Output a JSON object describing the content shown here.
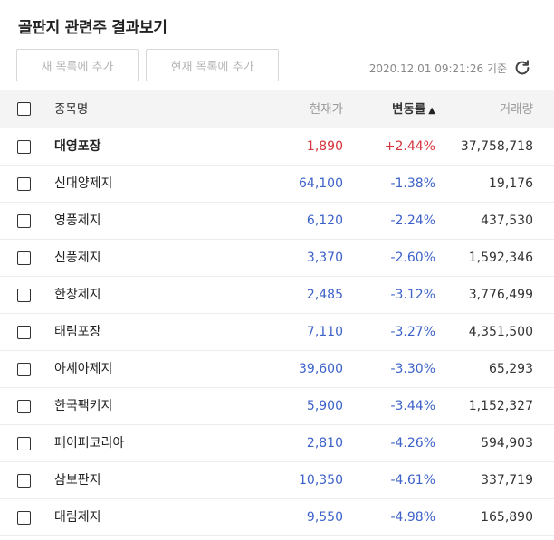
{
  "title": "골판지 관련주 결과보기",
  "buttons": {
    "add_new": "새 목록에 추가",
    "add_current": "현재 목록에 추가"
  },
  "timestamp": "2020.12.01 09:21:26 기준",
  "icons": {
    "refresh": "refresh-icon",
    "sort": "sort-ascending-icon"
  },
  "colors": {
    "up": "#d6333b",
    "down": "#3d62c9"
  },
  "table": {
    "headers": {
      "name": "종목명",
      "price": "현재가",
      "change": "변동률",
      "volume": "거래량",
      "sort_indicator": "▲"
    },
    "rows": [
      {
        "name": "대영포장",
        "price": "1,890",
        "change": "+2.44%",
        "volume": "37,758,718",
        "dir": "up"
      },
      {
        "name": "신대양제지",
        "price": "64,100",
        "change": "-1.38%",
        "volume": "19,176",
        "dir": "down"
      },
      {
        "name": "영풍제지",
        "price": "6,120",
        "change": "-2.24%",
        "volume": "437,530",
        "dir": "down"
      },
      {
        "name": "신풍제지",
        "price": "3,370",
        "change": "-2.60%",
        "volume": "1,592,346",
        "dir": "down"
      },
      {
        "name": "한창제지",
        "price": "2,485",
        "change": "-3.12%",
        "volume": "3,776,499",
        "dir": "down"
      },
      {
        "name": "태림포장",
        "price": "7,110",
        "change": "-3.27%",
        "volume": "4,351,500",
        "dir": "down"
      },
      {
        "name": "아세아제지",
        "price": "39,600",
        "change": "-3.30%",
        "volume": "65,293",
        "dir": "down"
      },
      {
        "name": "한국팩키지",
        "price": "5,900",
        "change": "-3.44%",
        "volume": "1,152,327",
        "dir": "down"
      },
      {
        "name": "페이퍼코리아",
        "price": "2,810",
        "change": "-4.26%",
        "volume": "594,903",
        "dir": "down"
      },
      {
        "name": "삼보판지",
        "price": "10,350",
        "change": "-4.61%",
        "volume": "337,719",
        "dir": "down"
      },
      {
        "name": "대림제지",
        "price": "9,550",
        "change": "-4.98%",
        "volume": "165,890",
        "dir": "down"
      }
    ]
  }
}
